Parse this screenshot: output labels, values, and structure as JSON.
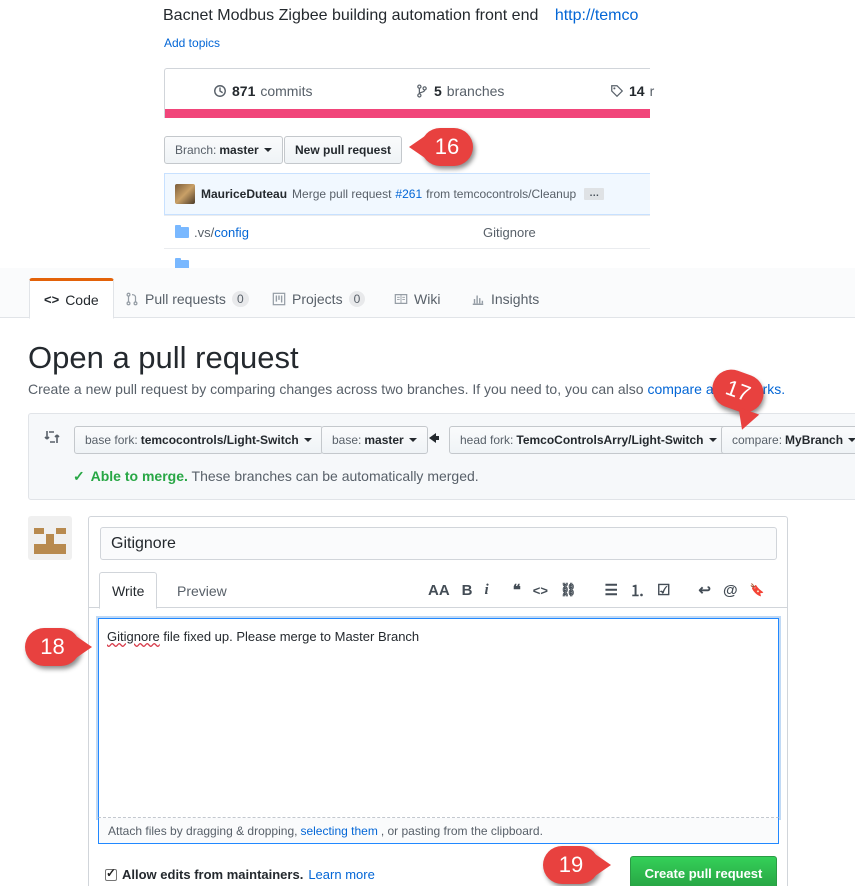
{
  "top_screenshot": {
    "description": "Bacnet Modbus Zigbee building automation front end",
    "homepage_link": "http://temco",
    "add_topics": "Add topics",
    "numbers": {
      "commits_count": "871",
      "commits_label": "commits",
      "branches_count": "5",
      "branches_label": "branches",
      "releases_count": "14",
      "releases_label": "r"
    },
    "branch_button": {
      "prefix": "Branch:",
      "value": "master"
    },
    "new_pull_request": "New pull request",
    "latest_commit": {
      "author": "MauriceDuteau",
      "message_prefix": "Merge pull request",
      "pr_number": "#261",
      "message_suffix": "from temcocontrols/Cleanup",
      "ellipsis": "…"
    },
    "files": [
      {
        "name_prefix": ".vs/",
        "name_link": "config",
        "message": "Gitignore"
      }
    ]
  },
  "repo_nav": {
    "tabs": [
      {
        "label": "Code",
        "counter": ""
      },
      {
        "label": "Pull requests",
        "counter": "0"
      },
      {
        "label": "Projects",
        "counter": "0"
      },
      {
        "label": "Wiki",
        "counter": ""
      },
      {
        "label": "Insights",
        "counter": ""
      }
    ]
  },
  "compare": {
    "title": "Open a pull request",
    "subtitle": "Create a new pull request by comparing changes across two branches. If you need to, you can also",
    "subtitle_link": "compare across forks.",
    "base_fork": {
      "prefix": "base fork:",
      "value": "temcocontrols/Light-Switch"
    },
    "base": {
      "prefix": "base:",
      "value": "master"
    },
    "head_fork": {
      "prefix": "head fork:",
      "value": "TemcoControlsArry/Light-Switch"
    },
    "compare_branch": {
      "prefix": "compare:",
      "value": "MyBranch"
    },
    "merge_status_strong": "Able to merge.",
    "merge_status_text": "These branches can be automatically merged."
  },
  "pr_form": {
    "title_value": "Gitignore",
    "write_tab": "Write",
    "preview_tab": "Preview",
    "toolbar": {
      "header": "AA",
      "bold": "B",
      "italic": "i",
      "quote": "❝",
      "code": "<>",
      "link": "⛓",
      "bullet_list": "☰",
      "numbered_list": "⒈",
      "task_list": "☑",
      "reply": "↩",
      "mention": "@",
      "bookmark": "🔖"
    },
    "body_spellword": "Gitignore",
    "body_rest": " file fixed up. Please merge to Master Branch",
    "attach_prefix": "Attach files by dragging & dropping,",
    "attach_link": "selecting them",
    "attach_suffix": ", or pasting from the clipboard.",
    "allow_edits_label": "Allow edits from maintainers.",
    "learn_more": "Learn more",
    "create_button": "Create pull request"
  },
  "annotations": [
    "16",
    "17",
    "18",
    "19"
  ],
  "colors": {
    "annotation_red": "#e8413f",
    "accent_blue": "#0366d6",
    "success_green": "#28a745",
    "language_bar_pink": "#f1457a",
    "active_tab_orange": "#e36209"
  }
}
